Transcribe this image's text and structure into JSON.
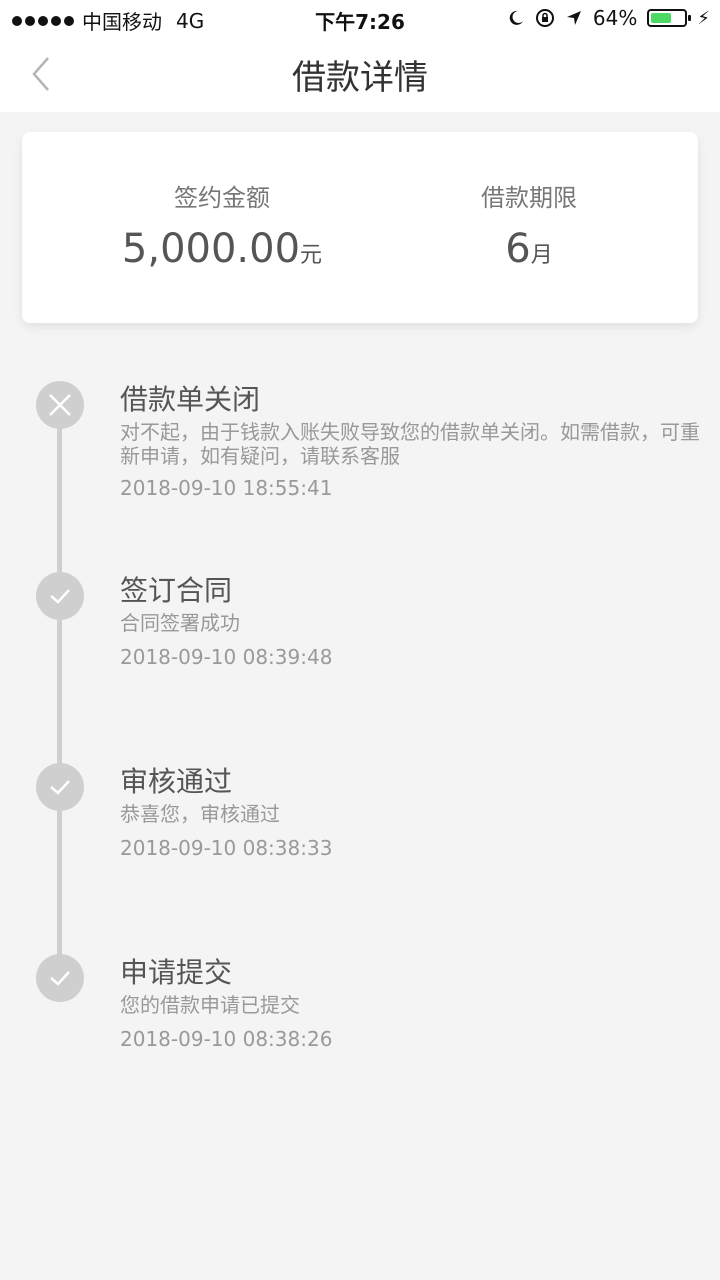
{
  "status_bar": {
    "carrier": "中国移动",
    "network": "4G",
    "time": "下午7:26",
    "battery_percent": "64%",
    "battery_level": 0.64,
    "battery_color": "#4cd964"
  },
  "header": {
    "title": "借款详情",
    "back_icon": "chevron-left-icon"
  },
  "summary": {
    "amount_label": "签约金额",
    "amount_value": "5,000.00",
    "amount_unit": "元",
    "term_label": "借款期限",
    "term_value": "6",
    "term_unit": "月"
  },
  "timeline": {
    "items": [
      {
        "title": "借款单关闭",
        "description": "对不起，由于钱款入账失败导致您的借款单关闭。如需借款，可重新申请，如有疑问，请联系客服",
        "time": "2018-09-10 18:55:41",
        "icon": "close-icon"
      },
      {
        "title": "签订合同",
        "description": "合同签署成功",
        "time": "2018-09-10 08:39:48",
        "icon": "check-icon"
      },
      {
        "title": "审核通过",
        "description": "恭喜您，审核通过",
        "time": "2018-09-10 08:38:33",
        "icon": "check-icon"
      },
      {
        "title": "申请提交",
        "description": "您的借款申请已提交",
        "time": "2018-09-10 08:38:26",
        "icon": "check-icon"
      }
    ]
  }
}
